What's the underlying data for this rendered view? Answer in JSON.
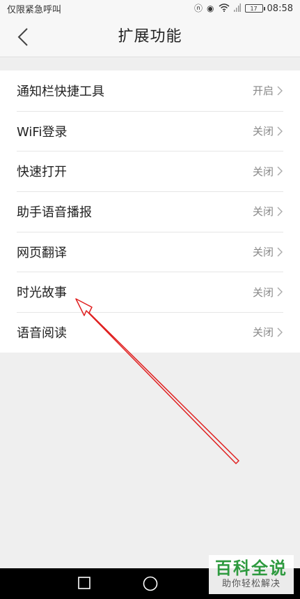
{
  "status_bar": {
    "carrier": "仅限紧急呼叫",
    "battery": "17",
    "time": "08:58"
  },
  "header": {
    "title": "扩展功能",
    "back_icon": "chevron-left-icon"
  },
  "settings": {
    "items": [
      {
        "label": "通知栏快捷工具",
        "status": "开启"
      },
      {
        "label": "WiFi登录",
        "status": "关闭"
      },
      {
        "label": "快速打开",
        "status": "关闭"
      },
      {
        "label": "助手语音播报",
        "status": "关闭"
      },
      {
        "label": "网页翻译",
        "status": "关闭"
      },
      {
        "label": "时光故事",
        "status": "关闭"
      },
      {
        "label": "语音阅读",
        "status": "关闭"
      }
    ]
  },
  "watermark": {
    "main": "百科全说",
    "sub": "助你轻松解决"
  },
  "colors": {
    "annotation_arrow": "#e02020",
    "watermark_green": "#2e9a3f"
  }
}
